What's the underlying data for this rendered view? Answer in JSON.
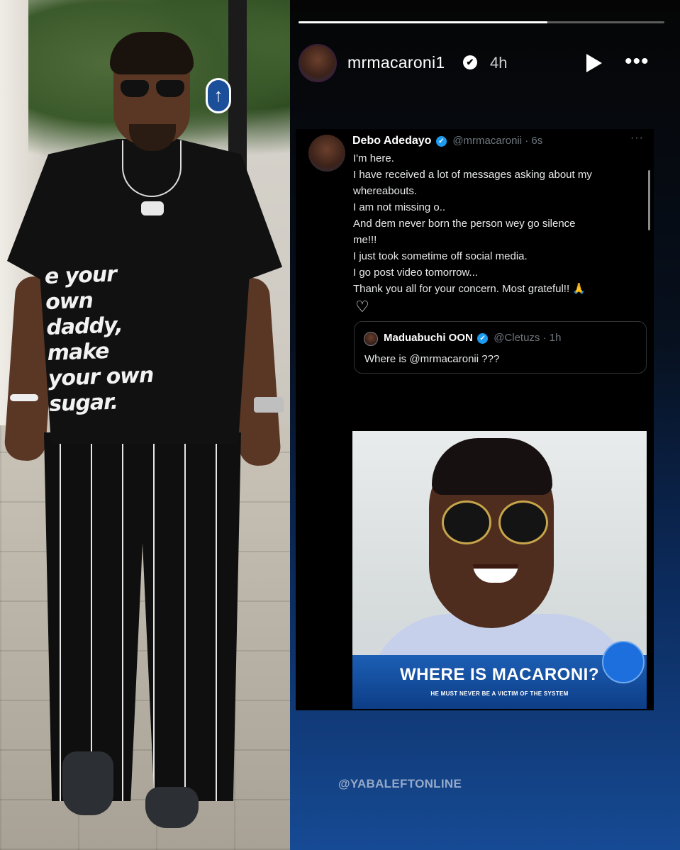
{
  "photo": {
    "shirt_lines": [
      "e your",
      "own",
      "daddy,",
      "make",
      "your own",
      "sugar."
    ],
    "traffic_sign_symbol": "↑"
  },
  "story": {
    "progress_fraction": 0.68,
    "username": "mrmacaroni1",
    "verified_icon": "verified-check-icon",
    "time": "4h",
    "play_icon": "play-icon",
    "more_icon": "more-options-icon",
    "more_symbol": "•••"
  },
  "tweet": {
    "author_name": "Debo Adedayo",
    "handle_time": "@mrmacaronii · 6s",
    "more_symbol": "···",
    "body_lines": [
      "I'm here.",
      "I have received a lot of messages asking about my",
      "whereabouts.",
      "I am not missing o..",
      "And dem never born the person wey go silence",
      "me!!!",
      "I just took sometime off social media.",
      "I go post video tomorrow...",
      "Thank you all for your concern. Most grateful!! 🙏"
    ],
    "heart": "♡"
  },
  "quote": {
    "author_name": "Maduabuchi OON",
    "handle_time": "@Cletuzs · 1h",
    "text": "Where is @mrmacaronii ???"
  },
  "media": {
    "banner_title": "WHERE IS MACARONI?",
    "banner_subtitle": "HE MUST NEVER BE A VICTIM OF THE SYSTEM"
  },
  "watermark": "@YABALEFTONLINE",
  "colors": {
    "twitter_blue": "#1d9bf0",
    "banner_blue": "#1c5fb5",
    "story_bottom": "#164a94"
  }
}
